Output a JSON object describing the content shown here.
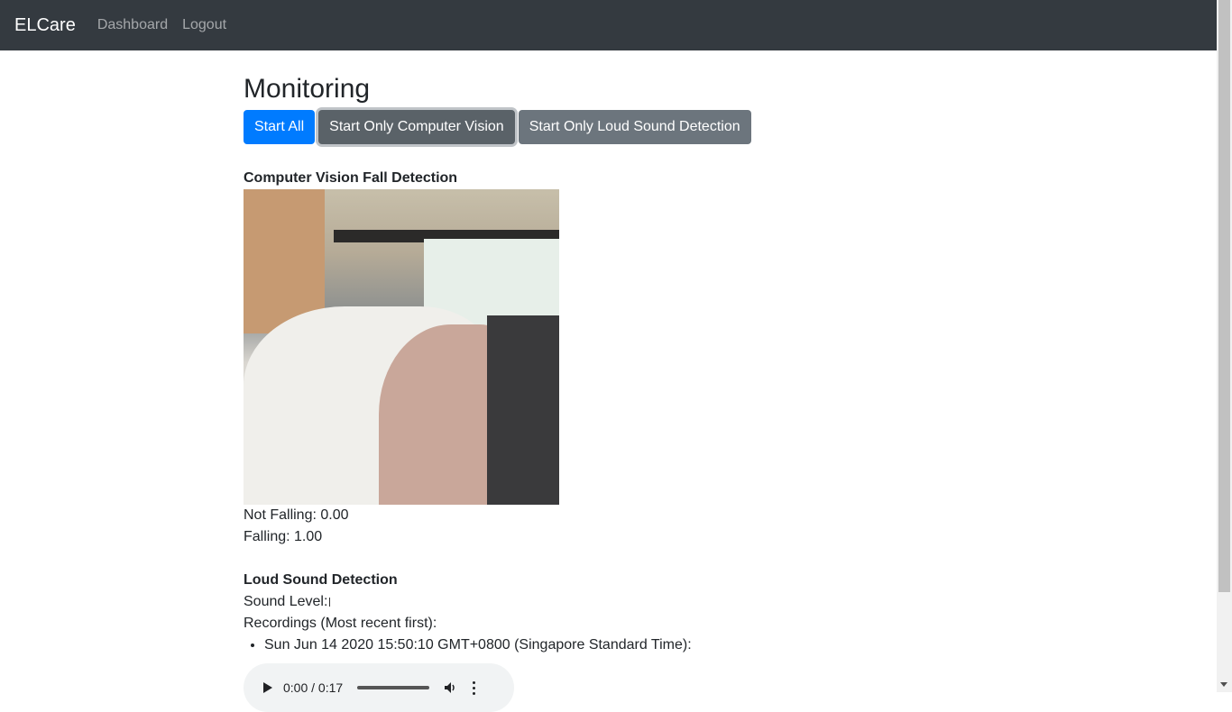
{
  "nav": {
    "brand": "ELCare",
    "links": [
      "Dashboard",
      "Logout"
    ]
  },
  "page_title": "Monitoring",
  "buttons": {
    "start_all": "Start All",
    "start_cv": "Start Only Computer Vision",
    "start_sound": "Start Only Loud Sound Detection"
  },
  "cv": {
    "title": "Computer Vision Fall Detection",
    "not_falling": "Not Falling: 0.00",
    "falling": "Falling: 1.00"
  },
  "sound": {
    "title": "Loud Sound Detection",
    "level_label": "Sound Level:",
    "recordings_label": "Recordings (Most recent first):",
    "recordings": [
      {
        "timestamp": "Sun Jun 14 2020 15:50:10 GMT+0800 (Singapore Standard Time):",
        "time": "0:00 / 0:17"
      }
    ]
  },
  "colors": {
    "navbar": "#343a40",
    "primary": "#007bff",
    "secondary": "#6c757d"
  }
}
